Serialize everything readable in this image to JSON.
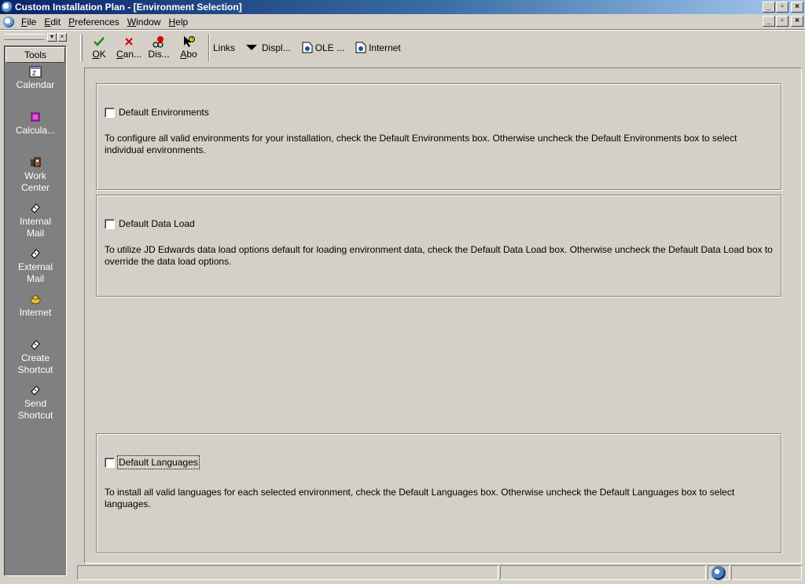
{
  "window": {
    "title": "Custom Installation Plan - [Environment Selection]",
    "btn_minimize": "_",
    "btn_restore": "▫",
    "btn_close": "×"
  },
  "menu": [
    {
      "label": "File",
      "accel": "F",
      "rest": "ile"
    },
    {
      "label": "Edit",
      "accel": "E",
      "rest": "dit"
    },
    {
      "label": "Preferences",
      "accel": "P",
      "rest": "references"
    },
    {
      "label": "Window",
      "accel": "W",
      "rest": "indow"
    },
    {
      "label": "Help",
      "accel": "H",
      "rest": "elp"
    }
  ],
  "tools_panel": {
    "header": "Tools",
    "items": [
      {
        "line1": "Calendar",
        "line2": "",
        "icon": "calendar-icon"
      },
      {
        "line1": "Calcula...",
        "line2": "",
        "icon": "calculator-icon"
      },
      {
        "line1": "Work",
        "line2": "Center",
        "icon": "work-center-icon"
      },
      {
        "line1": "Internal",
        "line2": "Mail",
        "icon": "internal-mail-icon"
      },
      {
        "line1": "External",
        "line2": "Mail",
        "icon": "external-mail-icon"
      },
      {
        "line1": "Internet",
        "line2": "",
        "icon": "internet-icon"
      },
      {
        "line1": "Create",
        "line2": "Shortcut",
        "icon": "create-shortcut-icon"
      },
      {
        "line1": "Send",
        "line2": "Shortcut",
        "icon": "send-shortcut-icon"
      }
    ]
  },
  "toolbar": {
    "ok": {
      "accel": "O",
      "rest": "K"
    },
    "cancel": {
      "accel": "C",
      "rest": "an..."
    },
    "display": {
      "accel": "",
      "rest": "Dis..."
    },
    "about": {
      "accel": "A",
      "rest": "bo"
    },
    "links": "Links",
    "display_menu": "Displ...",
    "ole": "OLE ...",
    "internet": "Internet"
  },
  "groups": {
    "environments": {
      "label": "Default Environments",
      "checked": false,
      "description": "To configure all valid environments for your installation, check the Default Environments box.  Otherwise uncheck the Default Environments box to select individual environments."
    },
    "data_load": {
      "label": "Default Data Load",
      "checked": false,
      "description": "To utilize JD Edwards data load options default for loading environment data, check the Default Data Load box.  Otherwise uncheck the Default Data Load box to override the data load options."
    },
    "languages": {
      "label": "Default Languages",
      "checked": false,
      "description": "To install all valid languages for each selected environment, check the Default Languages box.  Otherwise uncheck the Default Languages box to select languages."
    }
  },
  "colors": {
    "title_gradient_start": "#0a246a",
    "panel_gray": "#808080",
    "face": "#d4d0c8",
    "ok_green": "#1a8a1a",
    "cancel_red": "#d00000"
  }
}
